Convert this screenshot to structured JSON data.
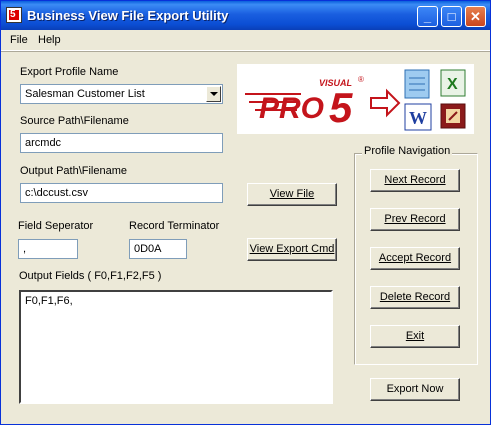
{
  "window": {
    "title": "Business View File Export Utility"
  },
  "menu": {
    "file": "File",
    "help": "Help"
  },
  "form": {
    "export_profile_label": "Export Profile Name",
    "export_profile_value": "Salesman Customer List",
    "source_label": "Source Path\\Filename",
    "source_value": "arcmdc",
    "output_label": "Output Path\\Filename",
    "output_value": "c:\\dccust.csv",
    "field_sep_label": "Field Seperator",
    "field_sep_value": ",",
    "record_term_label": "Record Terminator",
    "record_term_value": "0D0A",
    "output_fields_label": "Output Fields ( F0,F1,F2,F5 )",
    "output_fields_value": "F0,F1,F6,"
  },
  "buttons": {
    "view_file": "View File",
    "view_export_cmd": "View Export Cmd",
    "export_now": "Export Now"
  },
  "navigation": {
    "title": "Profile Navigation",
    "next": "Next Record",
    "prev": "Prev Record",
    "accept": "Accept Record",
    "delete": "Delete Record",
    "exit": "Exit"
  },
  "logo": {
    "visual": "VISUAL",
    "pro": "PRO",
    "five": "5",
    "registered": "®"
  },
  "colors": {
    "title_bar": "#0a5fdc",
    "logo_red": "#c4141b",
    "window_bg": "#ece9d8"
  }
}
